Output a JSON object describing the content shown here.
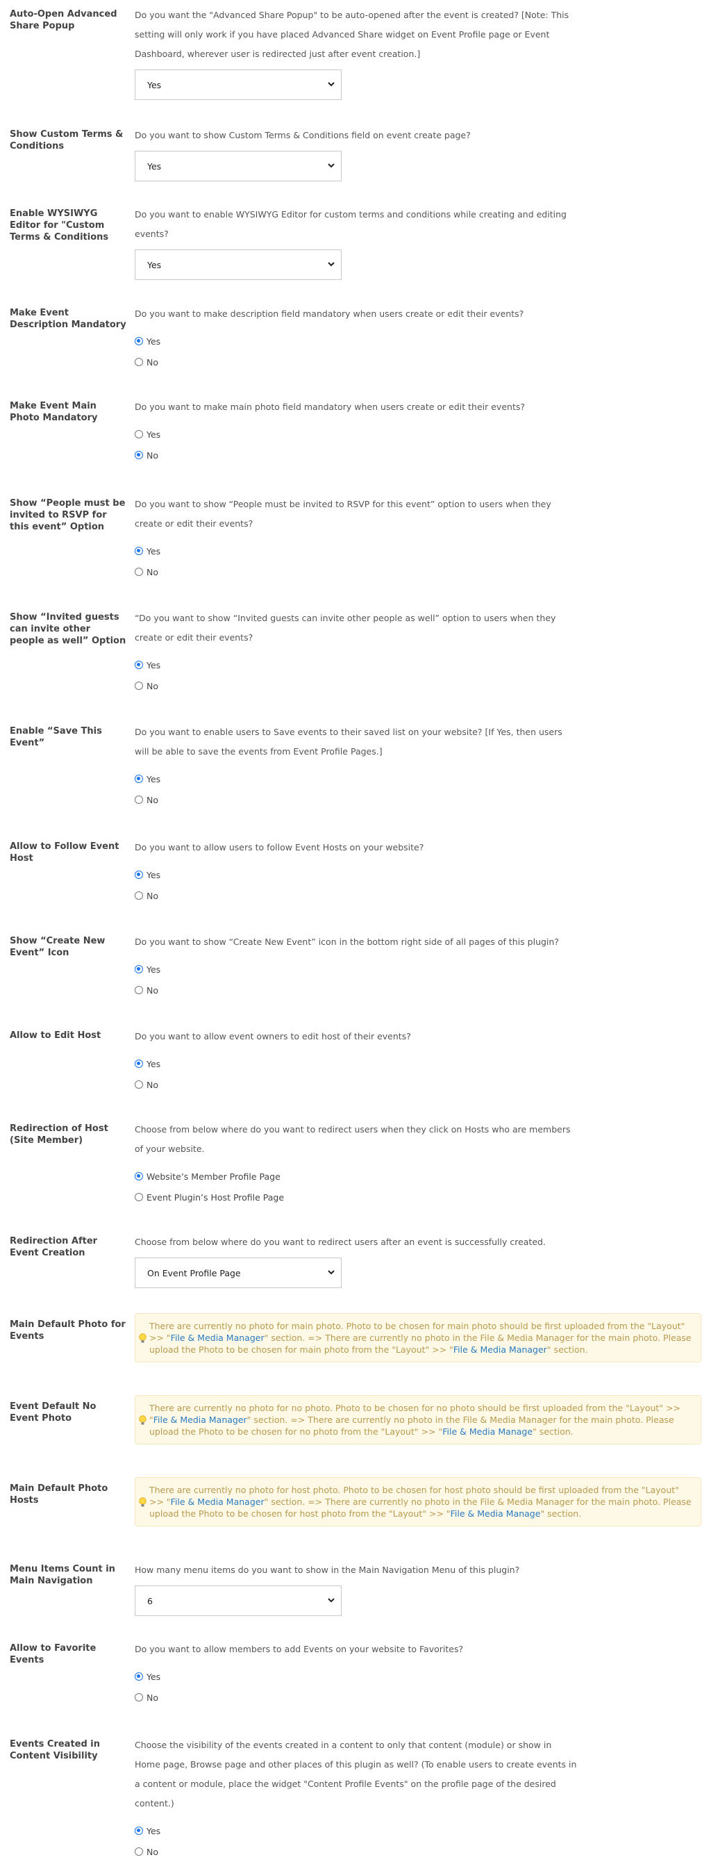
{
  "settings": [
    {
      "label": "Auto-Open Advanced Share Popup",
      "desc": "Do you want the \"Advanced Share Popup\" to be auto-opened after the event is created? [Note: This setting will only work if you have placed Advanced Share widget on Event Profile page or Event Dashboard, wherever user is redirected just after event creation.]",
      "type": "select",
      "value": "Yes"
    },
    {
      "label": "Show Custom Terms & Conditions",
      "desc": "Do you want to show Custom Terms & Conditions field on event create page?",
      "type": "select",
      "value": "Yes"
    },
    {
      "label": "Enable WYSIWYG Editor for \"Custom Terms & Conditions",
      "desc": "Do you want to enable WYSIWYG Editor for custom terms and conditions while creating and editing events?",
      "type": "select",
      "value": "Yes"
    },
    {
      "label": "Make Event Description Mandatory",
      "desc": "Do you want to make description field mandatory when users create or edit their events?",
      "type": "radio",
      "options": [
        "Yes",
        "No"
      ],
      "selected": "Yes"
    },
    {
      "label": "Make Event Main Photo Mandatory",
      "desc": "Do you want to make main photo field mandatory when users create or edit their events?",
      "type": "radio",
      "options": [
        "Yes",
        "No"
      ],
      "selected": "No"
    },
    {
      "label": "Show “People must be invited to RSVP for this event” Option",
      "desc": "Do you want to show “People must be invited to RSVP for this event” option to users when they create or edit their events?",
      "type": "radio",
      "options": [
        "Yes",
        "No"
      ],
      "selected": "Yes"
    },
    {
      "label": "Show “Invited guests can invite other people as well” Option",
      "desc": "“Do you want to show “Invited guests can invite other people as well” option to users when they create or edit their events?",
      "type": "radio",
      "options": [
        "Yes",
        "No"
      ],
      "selected": "Yes"
    },
    {
      "label": "Enable “Save This Event”",
      "desc": "Do you want to enable users to Save events to their saved list on your website? [If Yes, then users will be able to save the events from Event Profile Pages.]",
      "type": "radio",
      "options": [
        "Yes",
        "No"
      ],
      "selected": "Yes"
    },
    {
      "label": "Allow to Follow Event Host",
      "desc": "Do you want to allow users to follow Event Hosts on your website?",
      "type": "radio",
      "options": [
        "Yes",
        "No"
      ],
      "selected": "Yes"
    },
    {
      "label": "Show “Create New Event” Icon",
      "desc": "Do you want to show “Create New Event” icon in the bottom right side of all pages of this plugin?",
      "type": "radio",
      "options": [
        "Yes",
        "No"
      ],
      "selected": "Yes"
    },
    {
      "label": "Allow to Edit Host",
      "desc": "Do you want to allow event owners to edit host of their events?",
      "type": "radio",
      "options": [
        "Yes",
        "No"
      ],
      "selected": "Yes"
    },
    {
      "label": "Redirection of Host (Site Member)",
      "desc": "Choose from below where do you want to redirect users when they click on Hosts who are members of your website.",
      "type": "radio",
      "options": [
        "Website’s Member Profile Page",
        "Event Plugin’s Host Profile Page"
      ],
      "selected": "Website’s Member Profile Page"
    },
    {
      "label": "Redirection After Event Creation",
      "desc": "Choose from below where do you want to redirect users after an event is successfully created.",
      "type": "select",
      "value": "On Event Profile Page"
    },
    {
      "label": "Main Default Photo for Events",
      "type": "tip",
      "parts": [
        {
          "t": "There are currently no photo for main photo. Photo to be chosen for main photo should be first uploaded from the \"Layout\" >> \""
        },
        {
          "link": "File & Media Manager"
        },
        {
          "t": "\" section. => There are currently no photo in the File & Media Manager for the main photo. Please upload the Photo to be chosen for main photo from the \"Layout\" >> \""
        },
        {
          "link": "File & Media Manager"
        },
        {
          "t": "\" section."
        }
      ]
    },
    {
      "label": "Event Default No Event Photo",
      "type": "tip",
      "parts": [
        {
          "t": "There are currently no photo for no photo. Photo to be chosen for no photo should be first uploaded from the \"Layout\" >> \""
        },
        {
          "link": "File & Media Manager"
        },
        {
          "t": "\" section. => There are currently no photo in the File & Media Manager for the main photo. Please upload the Photo to be chosen for no photo from the \"Layout\" >> \""
        },
        {
          "link": "File & Media Manage"
        },
        {
          "t": "\" section."
        }
      ]
    },
    {
      "label": "Main Default Photo Hosts",
      "type": "tip",
      "parts": [
        {
          "t": "There are currently no photo for host photo. Photo to be chosen for host photo should be first uploaded from the \"Layout\" >> \""
        },
        {
          "link": "File & Media Manager"
        },
        {
          "t": "\" section. => There are currently no photo in the File & Media Manager for the main photo. Please upload the Photo to be chosen for host photo from the \"Layout\" >> \""
        },
        {
          "link": "File & Media Manage"
        },
        {
          "t": "\" section."
        }
      ]
    },
    {
      "label": "Menu Items Count in Main Navigation",
      "desc": "How many menu items do you want to show in the Main Navigation Menu of this plugin?",
      "type": "select",
      "value": "6"
    },
    {
      "label": "Allow to Favorite Events",
      "desc": "Do you want to allow members to add Events on your website to Favorites?",
      "type": "radio",
      "options": [
        "Yes",
        "No"
      ],
      "selected": "Yes"
    },
    {
      "label": "Events Created in Content Visibility",
      "desc": "Choose the visibility of the events created in a content to only that content (module) or show in Home page, Browse page and other places of this plugin as well? (To enable users to create events in a content or module, place the widget \"Content Profile Events\" on the profile page of the desired content.)",
      "type": "radio",
      "options": [
        "Yes",
        "No"
      ],
      "selected": "Yes"
    }
  ],
  "colors": {
    "accent": "#1a73e8",
    "tip_background": "#fef9e7",
    "tip_text": "#b79b4e",
    "link": "#2a7bc0"
  }
}
